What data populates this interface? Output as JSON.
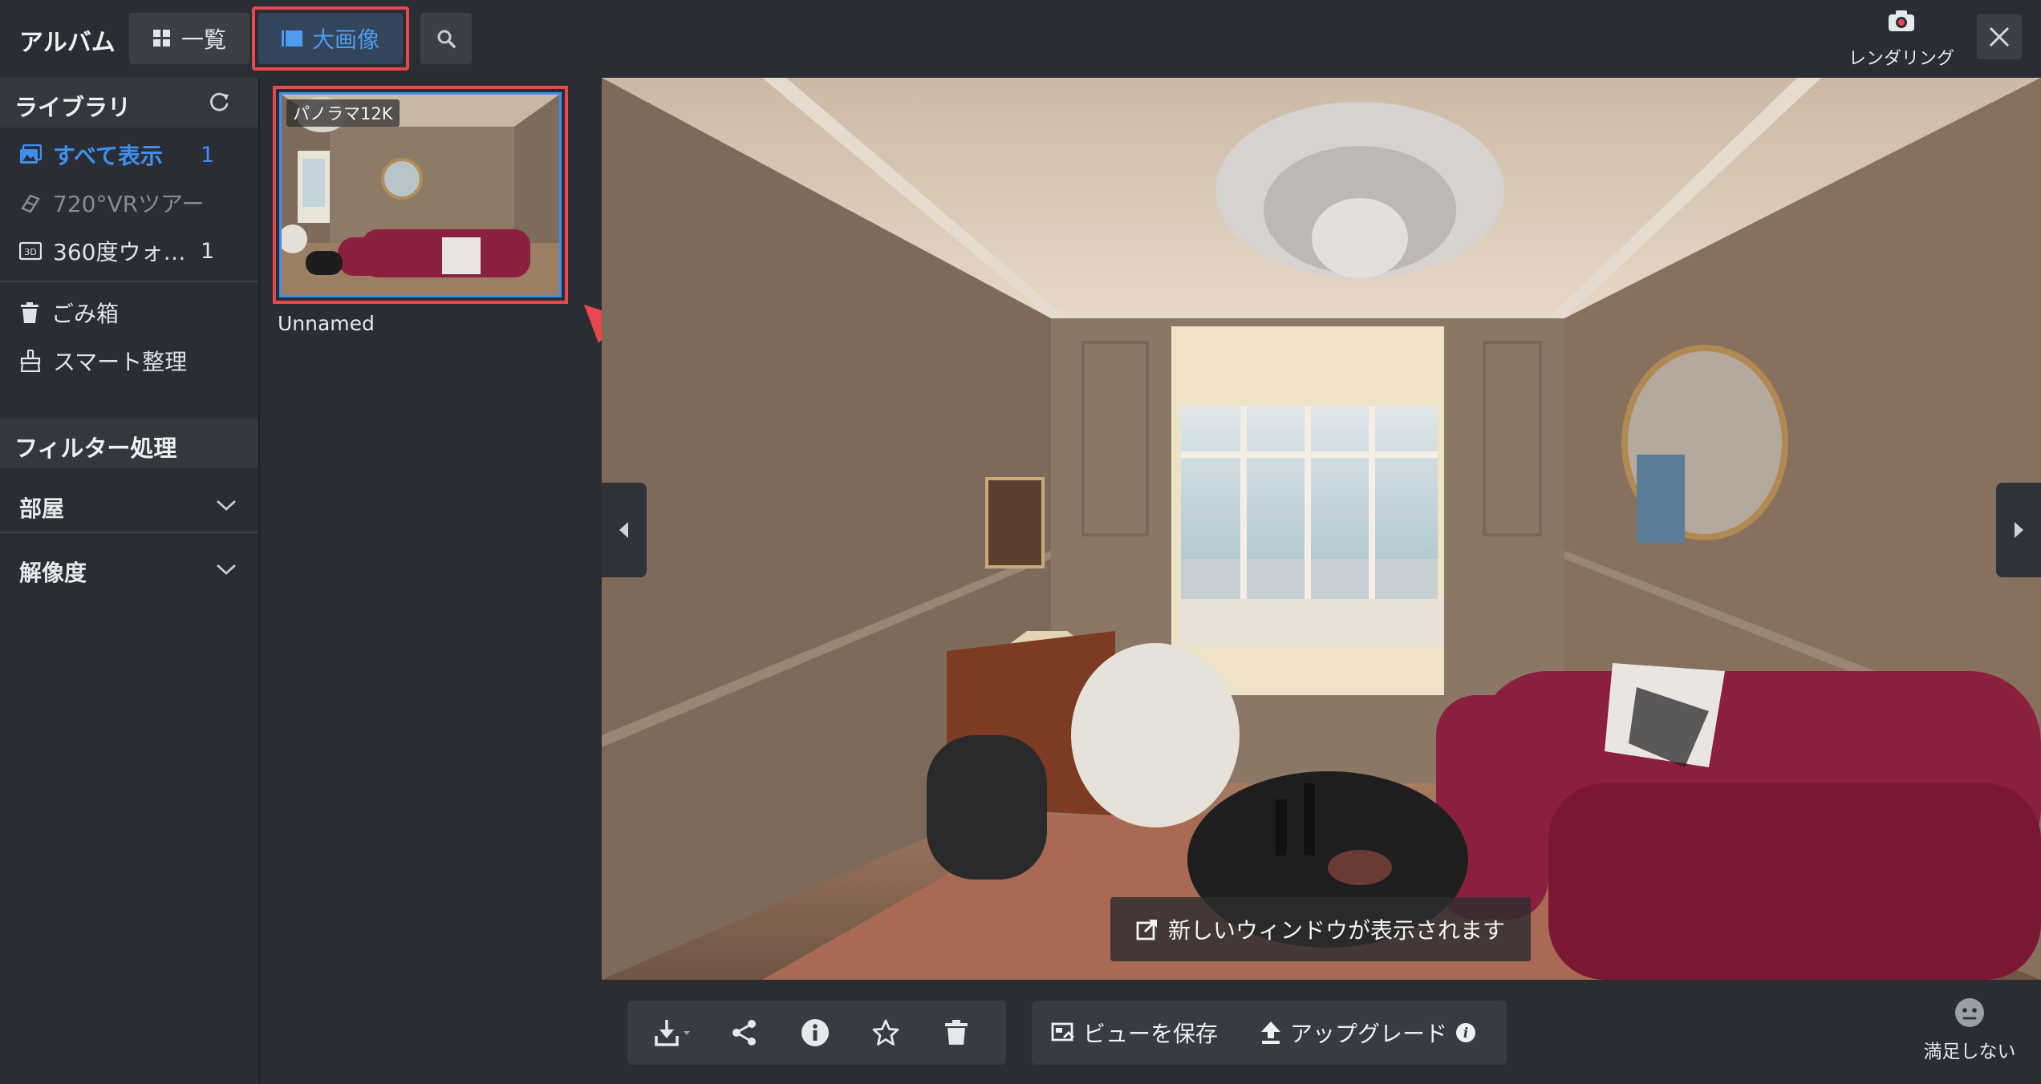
{
  "app": {
    "title": "アルバム"
  },
  "tabs": {
    "grid_label": "一覧",
    "large_label": "大画像"
  },
  "topbar": {
    "render_label": "レンダリング"
  },
  "sidebar": {
    "library_title": "ライブラリ",
    "items": [
      {
        "label": "すべて表示",
        "count": "1",
        "icon": "images-icon",
        "state": "active"
      },
      {
        "label": "720°VRツアー",
        "count": "",
        "icon": "vr-tour-icon",
        "state": "disabled"
      },
      {
        "label": "360度ウォ…",
        "count": "1",
        "icon": "panorama-360-icon",
        "state": "normal"
      }
    ],
    "trash_label": "ごみ箱",
    "smart_label": "スマート整理",
    "filter_title": "フィルター処理",
    "filters": [
      {
        "label": "部屋"
      },
      {
        "label": "解像度"
      }
    ]
  },
  "thumbnail": {
    "badge": "パノラマ12K",
    "name": "Unnamed"
  },
  "viewer": {
    "toast": "新しいウィンドウが表示されます"
  },
  "toolbar": {
    "save_view_label": "ビューを保存",
    "upgrade_label": "アップグレード",
    "dissatisfied_label": "満足しない"
  },
  "colors": {
    "accent": "#3f8ff0",
    "highlight": "#e8484d",
    "panel": "#2a2d33",
    "sofa": "#8a1f3e"
  }
}
